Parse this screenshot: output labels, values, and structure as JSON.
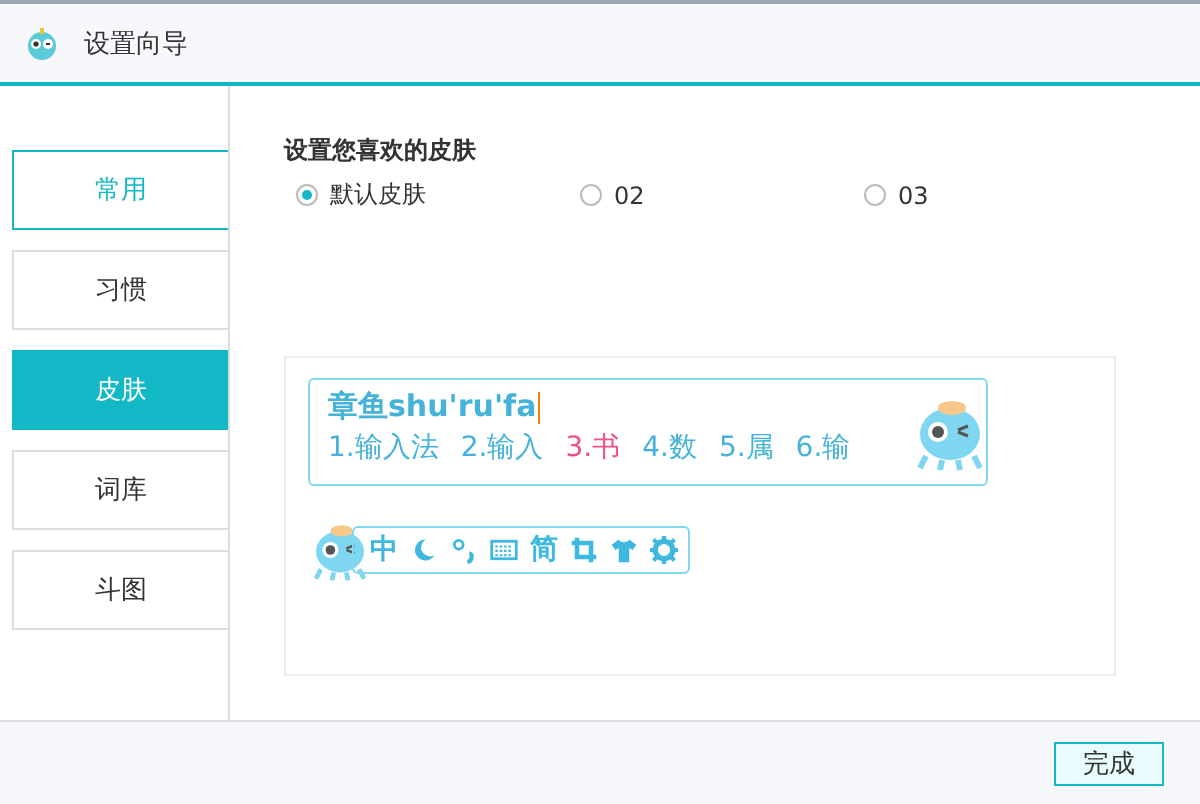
{
  "window": {
    "title": "设置向导"
  },
  "sidebar": {
    "items": [
      {
        "label": "常用",
        "selected": false,
        "focused": true
      },
      {
        "label": "习惯",
        "selected": false,
        "focused": false
      },
      {
        "label": "皮肤",
        "selected": true,
        "focused": false
      },
      {
        "label": "词库",
        "selected": false,
        "focused": false
      },
      {
        "label": "斗图",
        "selected": false,
        "focused": false
      }
    ]
  },
  "skin": {
    "heading": "设置您喜欢的皮肤",
    "options": [
      {
        "label": "默认皮肤",
        "selected": true
      },
      {
        "label": "02",
        "selected": false
      },
      {
        "label": "03",
        "selected": false
      }
    ],
    "preview": {
      "composition": "章鱼shu'ru'fa",
      "candidates": [
        {
          "text": "1.输入法",
          "selected": false
        },
        {
          "text": "2.输入",
          "selected": false
        },
        {
          "text": "3.书",
          "selected": true
        },
        {
          "text": "4.数",
          "selected": false
        },
        {
          "text": "5.属",
          "selected": false
        },
        {
          "text": "6.输",
          "selected": false
        }
      ],
      "toolbar": [
        {
          "kind": "text",
          "text": "中"
        },
        {
          "kind": "moon"
        },
        {
          "kind": "punct"
        },
        {
          "kind": "keyboard"
        },
        {
          "kind": "text",
          "text": "简"
        },
        {
          "kind": "crop"
        },
        {
          "kind": "shirt"
        },
        {
          "kind": "gear"
        }
      ]
    }
  },
  "footer": {
    "button": "完成"
  }
}
